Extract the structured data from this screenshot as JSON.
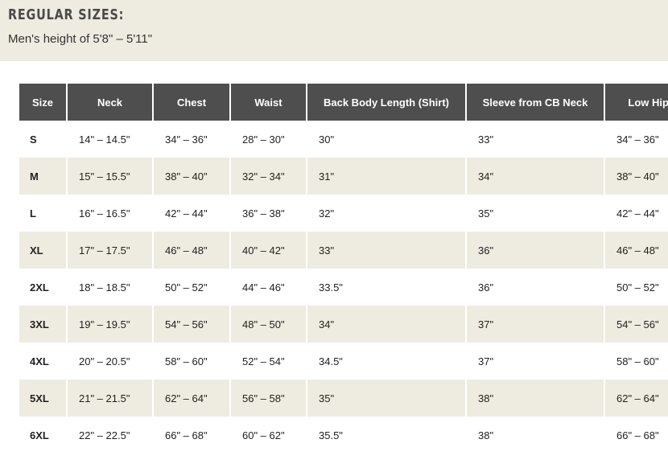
{
  "header": {
    "title": "REGULAR SIZES:",
    "subtitle": "Men's height of 5'8\" – 5'11\""
  },
  "table": {
    "columns": [
      "Size",
      "Neck",
      "Chest",
      "Waist",
      "Back Body Length (Shirt)",
      "Sleeve from CB Neck",
      "Low Hip Girth"
    ],
    "rows": [
      [
        "S",
        "14\" – 14.5\"",
        "34\" – 36\"",
        "28\" – 30\"",
        "30\"",
        "33\"",
        "34\" – 36\""
      ],
      [
        "M",
        "15\" – 15.5\"",
        "38\" – 40\"",
        "32\" – 34\"",
        "31\"",
        "34\"",
        "38\" – 40\""
      ],
      [
        "L",
        "16\" – 16.5\"",
        "42\" – 44\"",
        "36\" – 38\"",
        "32\"",
        "35\"",
        "42\" – 44\""
      ],
      [
        "XL",
        "17\" – 17.5\"",
        "46\" – 48\"",
        "40\" – 42\"",
        "33\"",
        "36\"",
        "46\" – 48\""
      ],
      [
        "2XL",
        "18\" – 18.5\"",
        "50\" – 52\"",
        "44\" – 46\"",
        "33.5\"",
        "36\"",
        "50\" – 52\""
      ],
      [
        "3XL",
        "19\" – 19.5\"",
        "54\" – 56\"",
        "48\" – 50\"",
        "34\"",
        "37\"",
        "54\" – 56\""
      ],
      [
        "4XL",
        "20\" – 20.5\"",
        "58\" – 60\"",
        "52\" – 54\"",
        "34.5\"",
        "37\"",
        "58\" – 60\""
      ],
      [
        "5XL",
        "21\" – 21.5\"",
        "62\" – 64\"",
        "56\" – 58\"",
        "35\"",
        "38\"",
        "62\" – 64\""
      ],
      [
        "6XL",
        "22\" – 22.5\"",
        "66\" – 68\"",
        "60\" – 62\"",
        "35.5\"",
        "38\"",
        "66\" – 68\""
      ]
    ]
  }
}
